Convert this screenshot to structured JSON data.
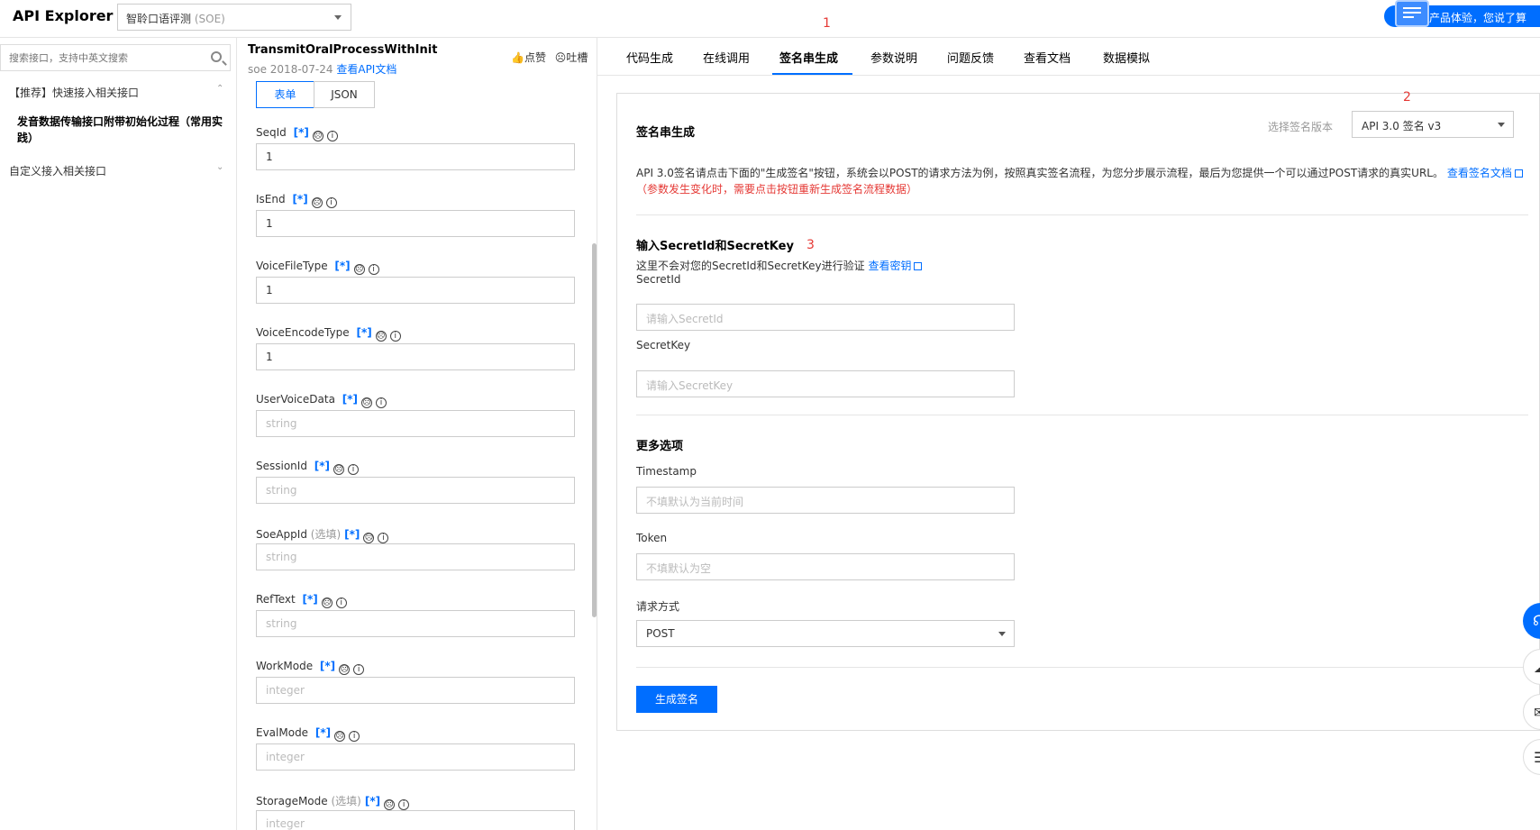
{
  "app": {
    "title": "API Explorer",
    "product_name": "智聆口语评测",
    "product_code": "(SOE)",
    "feedback_label": "产品体验，您说了算"
  },
  "markers": {
    "m1": "1",
    "m2": "2",
    "m3": "3"
  },
  "sidebar": {
    "search_placeholder": "搜索接口，支持中英文搜索",
    "groups": [
      {
        "label": "【推荐】快速接入相关接口",
        "expanded": true,
        "chevron": "⌃"
      },
      {
        "label": "自定义接入相关接口",
        "expanded": false,
        "chevron": "⌄"
      }
    ],
    "selected_item": "发音数据传输接口附带初始化过程（常用实践）"
  },
  "api": {
    "name": "TransmitOralProcessWithInit",
    "meta_prefix": "soe 2018-07-24",
    "doc_link": "查看API文档",
    "like_label": "点赞",
    "complain_label": "吐槽"
  },
  "form": {
    "mode_tabs": [
      "表单",
      "JSON"
    ],
    "active_mode": "表单",
    "params": [
      {
        "name": "SeqId",
        "optional": "",
        "badge": "[*]",
        "value": "1",
        "placeholder": ""
      },
      {
        "name": "IsEnd",
        "optional": "",
        "badge": "[*]",
        "value": "1",
        "placeholder": ""
      },
      {
        "name": "VoiceFileType",
        "optional": "",
        "badge": "[*]",
        "value": "1",
        "placeholder": ""
      },
      {
        "name": "VoiceEncodeType",
        "optional": "",
        "badge": "[*]",
        "value": "1",
        "placeholder": ""
      },
      {
        "name": "UserVoiceData",
        "optional": "",
        "badge": "[*]",
        "value": "",
        "placeholder": "string"
      },
      {
        "name": "SessionId",
        "optional": "",
        "badge": "[*]",
        "value": "",
        "placeholder": "string"
      },
      {
        "name": "SoeAppId",
        "optional": "(选填)",
        "badge": "[*]",
        "value": "",
        "placeholder": "string"
      },
      {
        "name": "RefText",
        "optional": "",
        "badge": "[*]",
        "value": "",
        "placeholder": "string"
      },
      {
        "name": "WorkMode",
        "optional": "",
        "badge": "[*]",
        "value": "",
        "placeholder": "integer"
      },
      {
        "name": "EvalMode",
        "optional": "",
        "badge": "[*]",
        "value": "",
        "placeholder": "integer"
      },
      {
        "name": "StorageMode",
        "optional": "(选填)",
        "badge": "[*]",
        "value": "",
        "placeholder": "integer"
      }
    ]
  },
  "tabs": [
    "代码生成",
    "在线调用",
    "签名串生成",
    "参数说明",
    "问题反馈",
    "查看文档",
    "数据模拟"
  ],
  "active_tab": "签名串生成",
  "signature": {
    "title": "签名串生成",
    "version_hint": "选择签名版本",
    "version_value": "API 3.0 签名 v3",
    "description": "API 3.0签名请点击下面的\"生成签名\"按钮，系统会以POST的请求方法为例，按照真实签名流程，为您分步展示流程，最后为您提供一个可以通过POST请求的真实URL。",
    "description_link": "查看签名文档",
    "warning": "（参数发生变化时，需要点击按钮重新生成签名流程数据）",
    "key_section_title": "输入SecretId和SecretKey",
    "key_note": "这里不会对您的SecretId和SecretKey进行验证",
    "key_note_link": "查看密钥",
    "secret_id_label": "SecretId",
    "secret_id_placeholder": "请输入SecretId",
    "secret_key_label": "SecretKey",
    "secret_key_placeholder": "请输入SecretKey",
    "more_title": "更多选项",
    "timestamp_label": "Timestamp",
    "timestamp_placeholder": "不填默认为当前时间",
    "token_label": "Token",
    "token_placeholder": "不填默认为空",
    "method_label": "请求方式",
    "method_value": "POST",
    "generate_button": "生成签名"
  },
  "colors": {
    "accent": "#006eff",
    "warning": "#e53935",
    "border": "#cccccc"
  }
}
